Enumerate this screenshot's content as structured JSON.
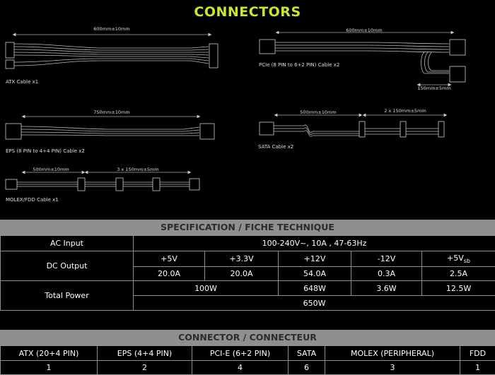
{
  "title": "CONNECTORS",
  "cables": {
    "atx": {
      "label": "ATX Cable x1",
      "length": "600mm±10mm"
    },
    "pcie": {
      "label": "PCIe (8 PIN to 6+2 PIN) Cable x2",
      "length": "600mm±10mm",
      "branch": "150mm±5mm"
    },
    "eps": {
      "label": "EPS (8 PIN to 4+4 PIN) Cable x2",
      "length": "750mm±10mm"
    },
    "sata": {
      "label": "SATA Cable x2",
      "length": "500mm±10mm",
      "branch": "2 x 150mm±5mm"
    },
    "molex": {
      "label": "MOLEX/FDD Cable x1",
      "length": "500mm±10mm",
      "branch": "3 x 150mm±5mm"
    }
  },
  "spec": {
    "heading": "SPECIFICATION / FICHE TECHNIQUE",
    "ac_input_label": "AC Input",
    "ac_input_value": "100-240V~, 10A , 47-63Hz",
    "dc_output_label": "DC Output",
    "rails": [
      "+5V",
      "+3.3V",
      "+12V",
      "-12V",
      "+5V"
    ],
    "rail_sub": "sb",
    "currents": [
      "20.0A",
      "20.0A",
      "54.0A",
      "0.3A",
      "2.5A"
    ],
    "total_power_label": "Total Power",
    "power_5v_3v3": "100W",
    "power_12v": "648W",
    "power_m12v": "3.6W",
    "power_5vsb": "12.5W",
    "power_total": "650W"
  },
  "connector": {
    "heading": "CONNECTOR / CONNECTEUR",
    "headers": [
      "ATX (20+4 PIN)",
      "EPS (4+4 PIN)",
      "PCI-E (6+2 PIN)",
      "SATA",
      "MOLEX (PERIPHERAL)",
      "FDD"
    ],
    "values": [
      "1",
      "2",
      "4",
      "6",
      "3",
      "1"
    ]
  }
}
